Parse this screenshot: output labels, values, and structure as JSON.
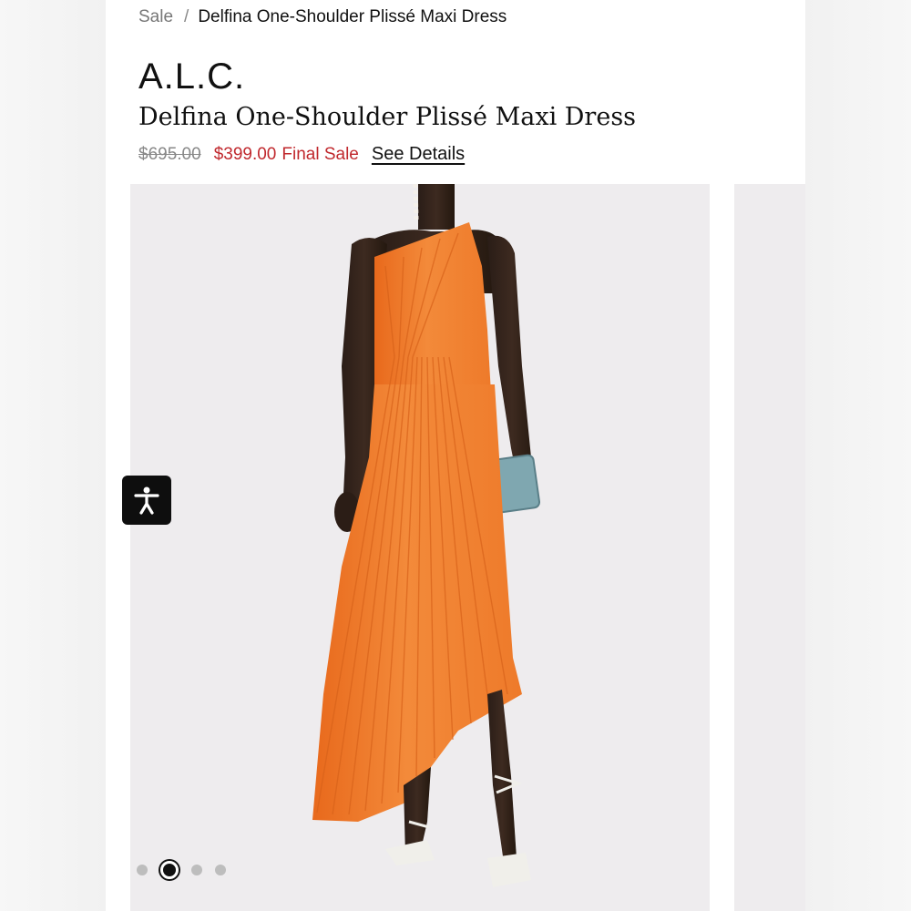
{
  "breadcrumb": {
    "parent": "Sale",
    "separator": "/",
    "current": "Delfina One-Shoulder Plissé Maxi Dress"
  },
  "product": {
    "brand": "A.L.C.",
    "title": "Delfina One-Shoulder Plissé Maxi Dress",
    "original_price": "$695.00",
    "sale_price": "$399.00",
    "sale_note": "Final Sale",
    "details_link": "See Details"
  },
  "gallery": {
    "image_count": 4,
    "active_index": 1
  },
  "colors": {
    "sale_red": "#c0282d",
    "dress_orange": "#f07d2c",
    "panel_bg": "#eeecee"
  },
  "icons": {
    "accessibility": "accessibility-icon"
  }
}
